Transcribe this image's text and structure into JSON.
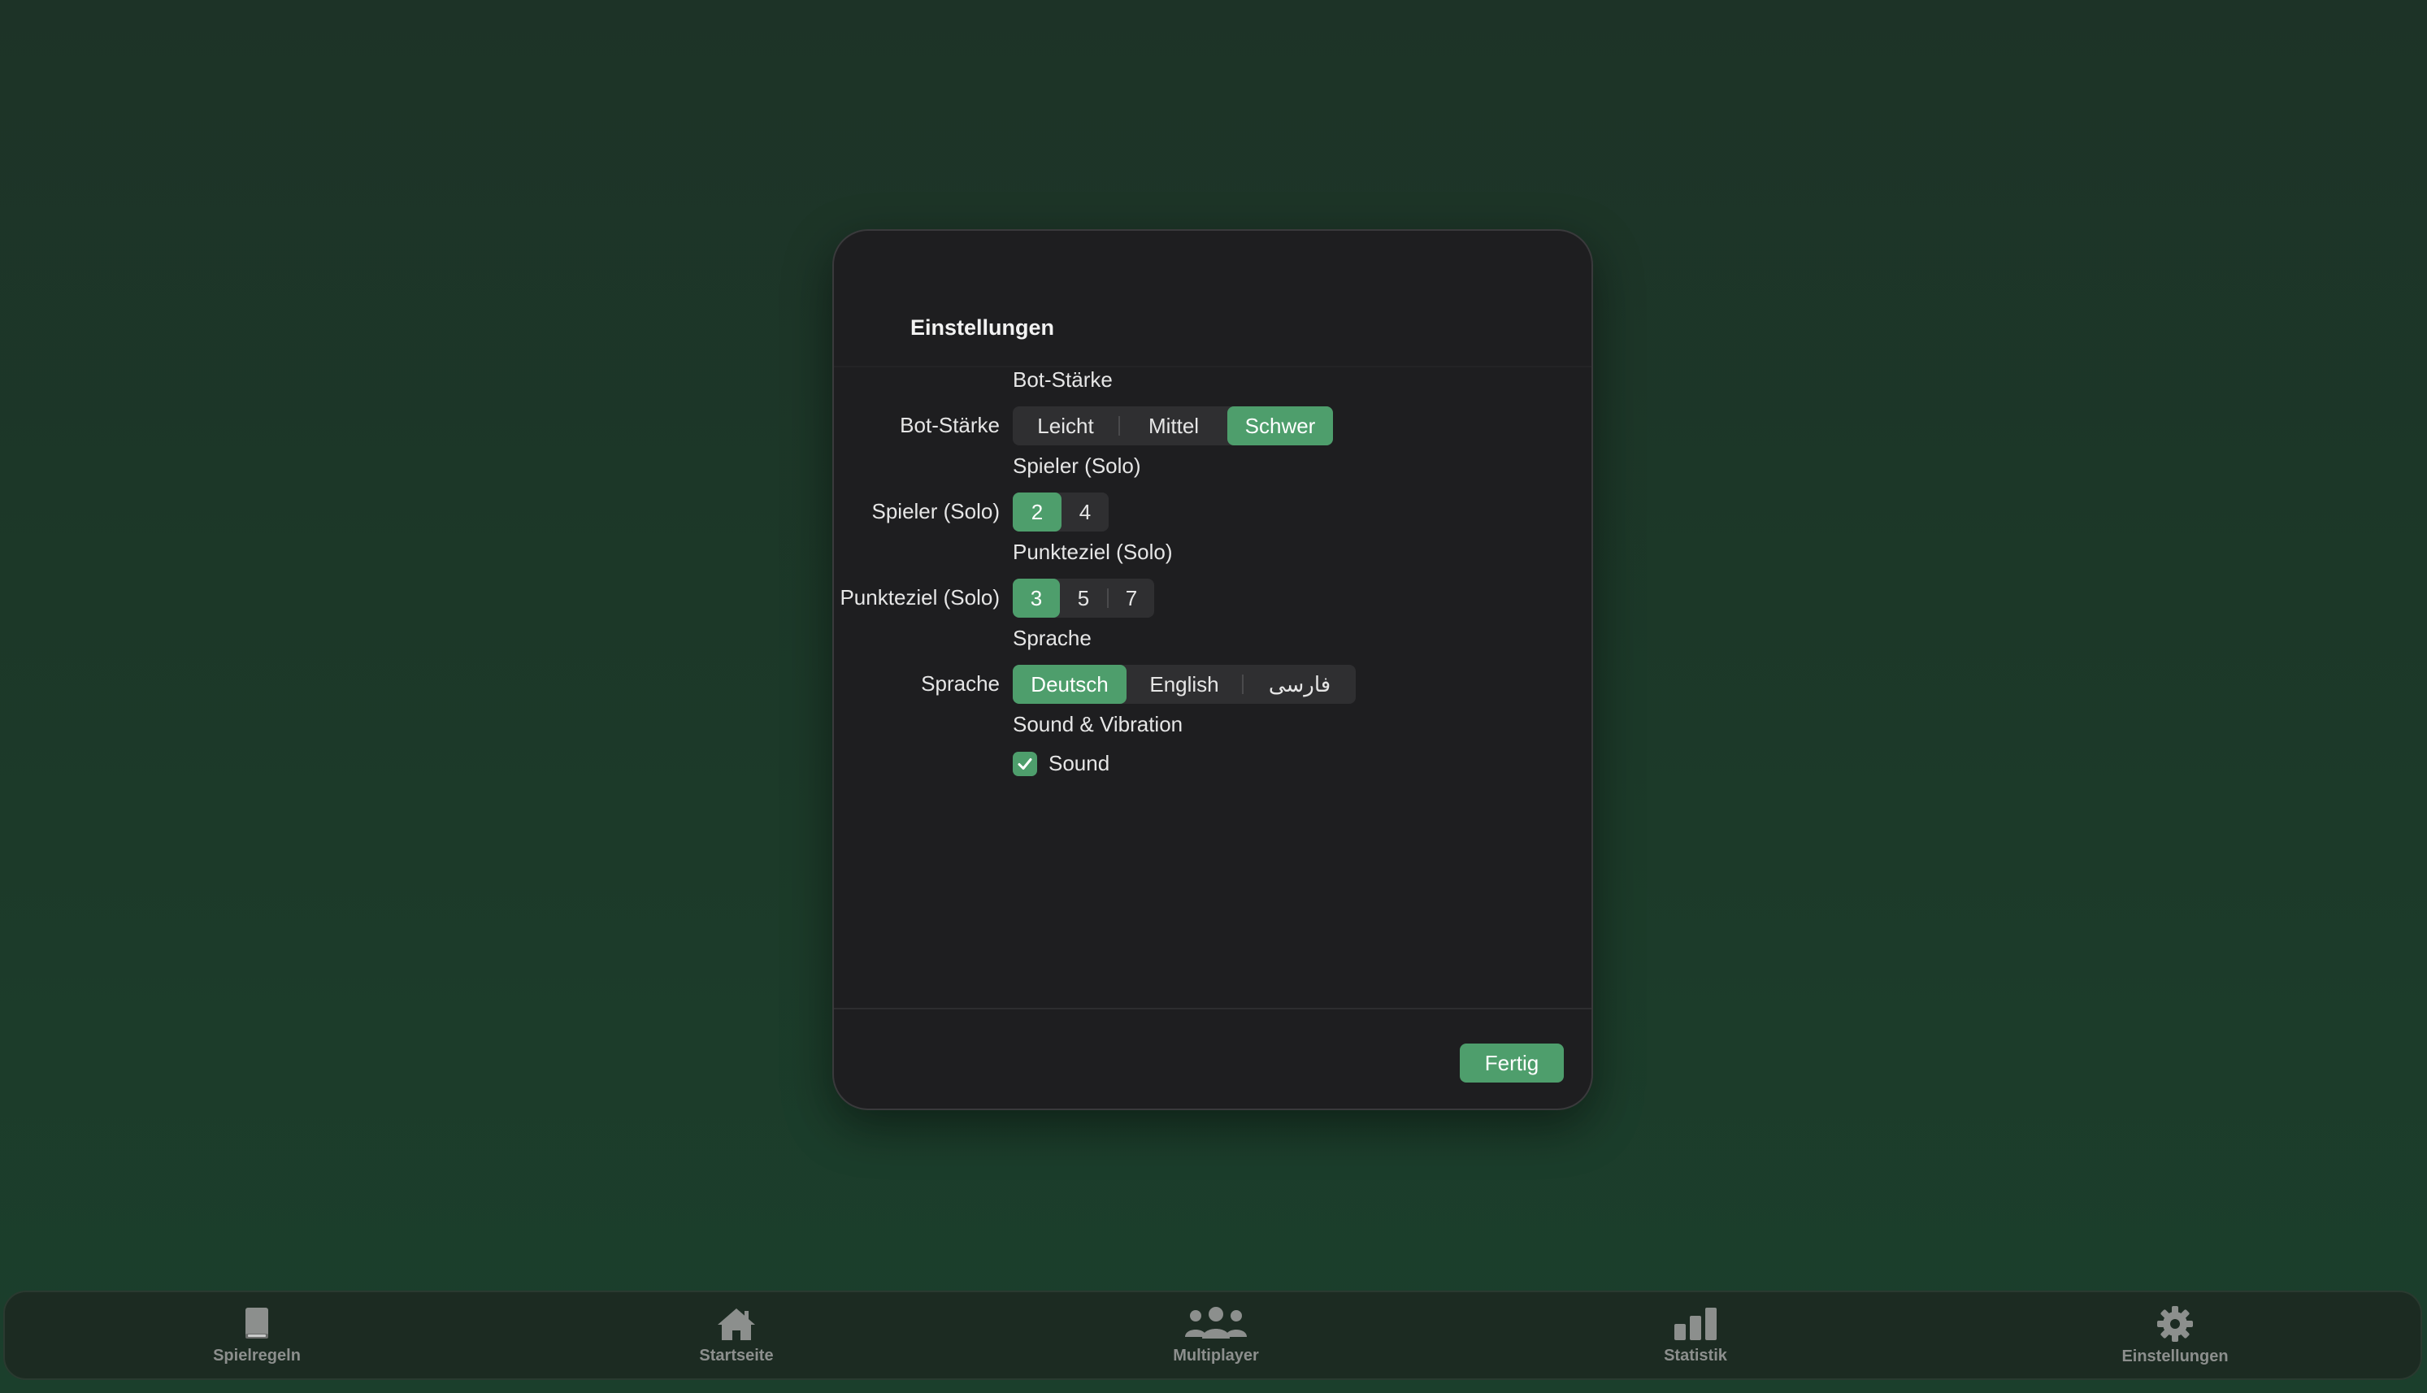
{
  "dialog": {
    "title": "Einstellungen",
    "bot_strength": {
      "label": "Bot-Stärke",
      "heading": "Bot-Stärke",
      "options": [
        "Leicht",
        "Mittel",
        "Schwer"
      ],
      "selected": "Schwer"
    },
    "players_solo": {
      "label": "Spieler (Solo)",
      "heading": "Spieler (Solo)",
      "options": [
        "2",
        "4"
      ],
      "selected": "2"
    },
    "points_target": {
      "label": "Punkteziel (Solo)",
      "heading": "Punkteziel (Solo)",
      "options": [
        "3",
        "5",
        "7"
      ],
      "selected": "3"
    },
    "language": {
      "label": "Sprache",
      "heading": "Sprache",
      "options": [
        "Deutsch",
        "English",
        "فارسی"
      ],
      "selected": "Deutsch"
    },
    "sound_vibration": {
      "heading": "Sound & Vibration",
      "sound_label": "Sound",
      "sound_checked": true
    },
    "done_label": "Fertig"
  },
  "tabbar": {
    "items": [
      {
        "label": "Spielregeln",
        "icon": "book-icon"
      },
      {
        "label": "Startseite",
        "icon": "house-icon"
      },
      {
        "label": "Multiplayer",
        "icon": "people-icon"
      },
      {
        "label": "Statistik",
        "icon": "bar-chart-icon"
      },
      {
        "label": "Einstellungen",
        "icon": "gear-icon"
      }
    ]
  },
  "colors": {
    "accent": "#4e9e6c",
    "dialog_bg": "#1e1e20",
    "background": "#1c3a29"
  }
}
